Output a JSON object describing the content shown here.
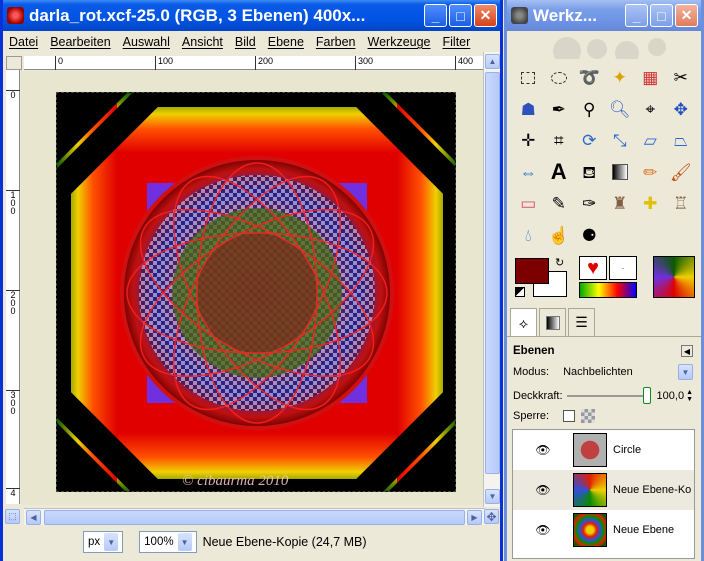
{
  "image_window": {
    "title": "darla_rot.xcf-25.0 (RGB, 3 Ebenen) 400x...",
    "buttons": {
      "minimize": "_",
      "maximize": "□",
      "close": "✕"
    },
    "menu": [
      "Datei",
      "Bearbeiten",
      "Auswahl",
      "Ansicht",
      "Bild",
      "Ebene",
      "Farben",
      "Werkzeuge",
      "Filter"
    ],
    "ruler_h": [
      "0",
      "100",
      "200",
      "300",
      "400"
    ],
    "ruler_v": [
      "0",
      "1\n0\n0",
      "2\n0\n0",
      "3\n0\n0",
      "4"
    ],
    "watermark": "© cibaurma 2010",
    "status": {
      "unit": "px",
      "zoom": "100%",
      "layer_info": "Neue Ebene-Kopie (24,7 MB)"
    }
  },
  "toolbox_window": {
    "title": "Werkz...",
    "tools": [
      "rect-select",
      "ellipse-select",
      "lasso",
      "fuzzy-select",
      "color-select",
      "scissors",
      "foreground-select",
      "paths",
      "color-picker",
      "zoom",
      "measure",
      "move",
      "align",
      "crop",
      "rotate",
      "scale",
      "shear",
      "perspective",
      "flip",
      "text",
      "bucket-fill",
      "blend",
      "pencil",
      "paintbrush",
      "eraser",
      "airbrush",
      "ink",
      "clone",
      "heal",
      "perspective-clone",
      "blur",
      "smudge",
      "dodge-burn"
    ],
    "fg_color": "#7d0000",
    "bg_color": "#ffffff"
  },
  "layers": {
    "title": "Ebenen",
    "mode_label": "Modus:",
    "mode_value": "Nachbelichten",
    "opacity_label": "Deckkraft:",
    "opacity_value": "100,0",
    "lock_label": "Sperre:",
    "items": [
      {
        "name": "Circle"
      },
      {
        "name": "Neue Ebene-Ko"
      },
      {
        "name": "Neue Ebene"
      }
    ]
  }
}
